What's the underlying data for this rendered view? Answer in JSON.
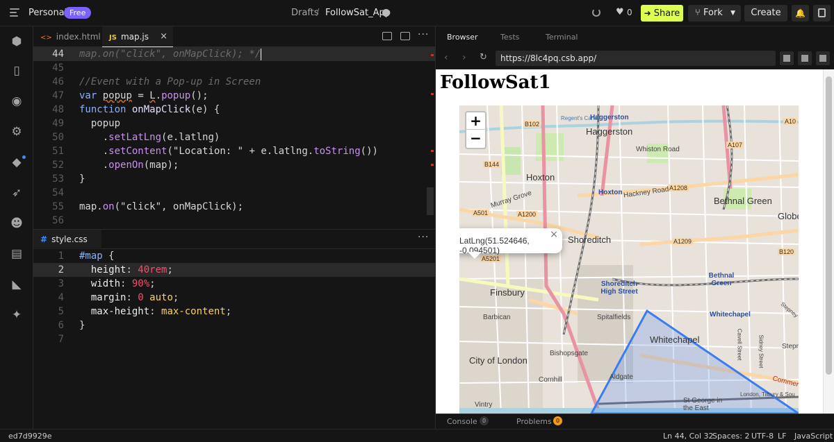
{
  "topbar": {
    "workspace": "Personal",
    "plan_badge": "Free",
    "breadcrumb_folder": "Drafts",
    "breadcrumb_sep": "/",
    "project_name": "FollowSat_App",
    "like_count": "0",
    "share_label": "Share",
    "fork_label": "Fork",
    "create_label": "Create"
  },
  "editor": {
    "tabs": [
      {
        "label": "index.html",
        "icon": "<>"
      },
      {
        "label": "map.js",
        "icon": "JS"
      }
    ],
    "js_lines": [
      {
        "n": "44",
        "text": "map.on(\"click\", onMapClick); */"
      },
      {
        "n": "45",
        "text": ""
      },
      {
        "n": "46",
        "text": "//Event with a Pop-up in Screen"
      },
      {
        "n": "47",
        "text": "var popup = L.popup();"
      },
      {
        "n": "48",
        "text": "function onMapClick(e) {"
      },
      {
        "n": "49",
        "text": "  popup"
      },
      {
        "n": "50",
        "text": "    .setLatLng(e.latlng)"
      },
      {
        "n": "51",
        "text": "    .setContent(\"Location: \" + e.latlng.toString())"
      },
      {
        "n": "52",
        "text": "    .openOn(map);"
      },
      {
        "n": "53",
        "text": "}"
      },
      {
        "n": "54",
        "text": ""
      },
      {
        "n": "55",
        "text": "map.on(\"click\", onMapClick);"
      },
      {
        "n": "56",
        "text": ""
      }
    ],
    "css_tab": {
      "label": "style.css",
      "icon": "#"
    },
    "css_lines": [
      {
        "n": "1",
        "text": "#map {"
      },
      {
        "n": "2",
        "text": "  height: 40rem;"
      },
      {
        "n": "3",
        "text": "  width: 90%;"
      },
      {
        "n": "4",
        "text": "  margin: 0 auto;"
      },
      {
        "n": "5",
        "text": "  max-height: max-content;"
      },
      {
        "n": "6",
        "text": "}"
      },
      {
        "n": "7",
        "text": ""
      }
    ]
  },
  "preview": {
    "tabs": [
      "Browser",
      "Tests",
      "Terminal"
    ],
    "url": "https://8lc4pq.csb.app/",
    "page_title": "FollowSat1",
    "popup_text": "LatLng(51.524646, -0.094501)",
    "popup_close": "×",
    "zoom_in": "+",
    "zoom_out": "−",
    "map_labels": {
      "haggerston": "Haggerston",
      "haggerston_station": "Haggerston",
      "whiston_road": "Whiston Road",
      "hoxton": "Hoxton",
      "hoxton_station": "Hoxton",
      "hackney_road": "Hackney Road",
      "murray_grove": "Murray Grove",
      "bethnal_green": "Bethnal Green",
      "globe": "Globe",
      "shoreditch": "Shoreditch",
      "shoreditch_high_street": "Shoreditch High Street",
      "bethnal_green_station": "Bethnal Green",
      "finsbury": "Finsbury",
      "barbican": "Barbican",
      "spitalfields": "Spitalfields",
      "whitechapel": "Whitechapel",
      "whitechapel_station": "Whitechapel",
      "bishopsgate": "Bishopsgate",
      "city_of_london": "City of London",
      "aldgate": "Aldgate",
      "cornhill": "Cornhill",
      "st_george": "St George in the East",
      "vintry": "Vintry",
      "commercial": "Commerce",
      "cavell_street": "Cavell Street",
      "sidney_street": "Sidney Street",
      "stepney": "Stepney",
      "stepne": "Stepne",
      "regents_canal": "Regent's Canal",
      "london_tilbury": "London, Tilbury & Sou"
    },
    "road_tags": {
      "b102": "B102",
      "a10": "A10",
      "a107": "A107",
      "b144": "B144",
      "a1208": "A1208",
      "a501": "A501",
      "a1200": "A1200",
      "a1209": "A1209",
      "b120": "B120",
      "a5201": "A5201"
    },
    "console_label": "Console",
    "console_count": "0",
    "problems_label": "Problems",
    "problems_count": "0"
  },
  "statusbar": {
    "commit": "ed7d9929e",
    "position": "Ln 44, Col 32",
    "spaces": "Spaces: 2",
    "encoding": "UTF-8",
    "eol": "LF",
    "language": "JavaScript"
  },
  "colors": {
    "accent_share": "#dcff50",
    "plan_badge": "#7b61ff",
    "polygon": "#3b7cf0"
  }
}
